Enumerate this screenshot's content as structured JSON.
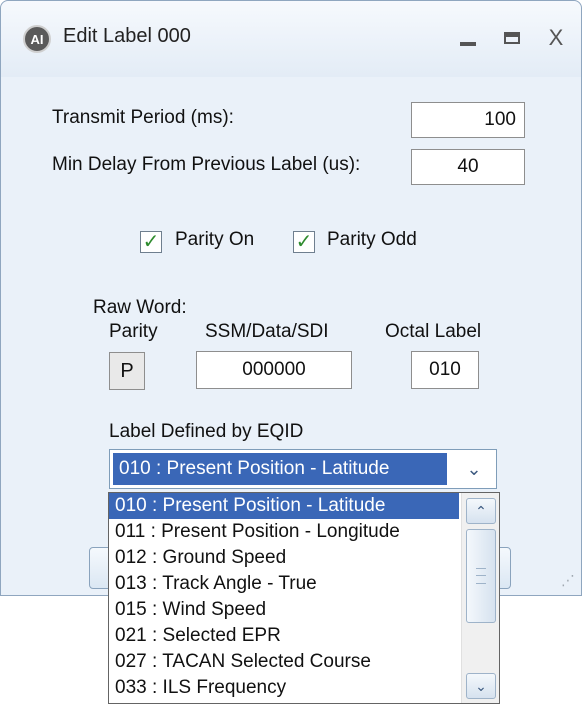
{
  "window": {
    "title": "Edit Label 000",
    "icon": "app-logo-icon",
    "icon_text": "AI",
    "controls": {
      "minimize": "_",
      "maximize": "□",
      "close": "X"
    }
  },
  "form": {
    "transmit_period_label": "Transmit Period (ms):",
    "transmit_period_value": "100",
    "min_delay_label": "Min Delay From Previous Label (us):",
    "min_delay_value": "40",
    "parity_on_label": "Parity On",
    "parity_on_checked": true,
    "parity_odd_label": "Parity Odd",
    "parity_odd_checked": true
  },
  "raw_word": {
    "heading": "Raw Word:",
    "parity_header": "Parity",
    "ssm_header": "SSM/Data/SDI",
    "octal_header": "Octal Label",
    "parity_value": "P",
    "ssm_value": "000000",
    "octal_value": "010"
  },
  "eqid": {
    "label": "Label Defined by EQID",
    "selected": "010 : Present Position - Latitude",
    "options": [
      "010 : Present Position - Latitude",
      "011 : Present Position - Longitude",
      "012 : Ground Speed",
      "013 : Track Angle - True",
      "015 : Wind Speed",
      "021 : Selected EPR",
      "027 : TACAN Selected Course",
      "033 : ILS Frequency"
    ],
    "highlighted_index": 0
  },
  "colors": {
    "selection": "#3a67b7",
    "window_bg": "#eaf1f9",
    "check_green": "#2e8b2e"
  }
}
